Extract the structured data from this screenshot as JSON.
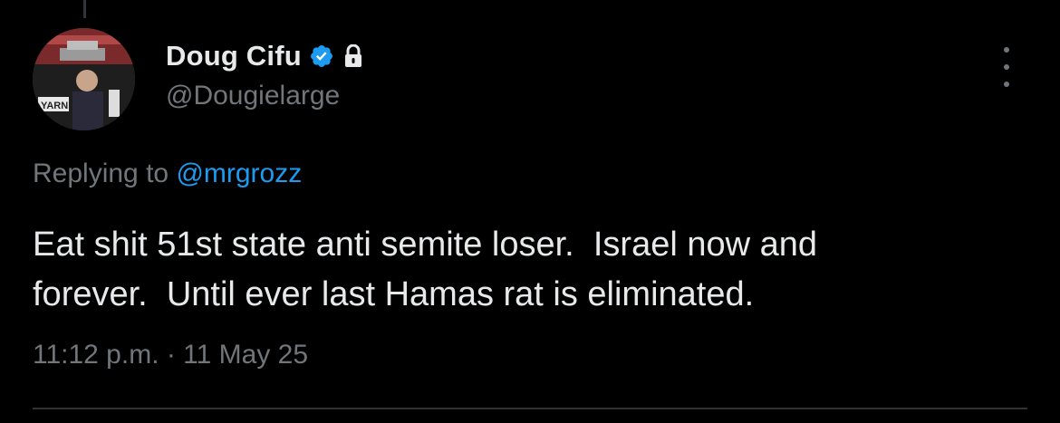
{
  "tweet": {
    "author": {
      "display_name": "Doug Cifu",
      "handle": "@Dougielarge",
      "verified": true,
      "protected": true,
      "avatar_text": "YARN"
    },
    "reply": {
      "prefix": "Replying to ",
      "mention": "@mrgrozz"
    },
    "text": "Eat shit 51st state anti semite loser.  Israel now and\nforever.  Until ever last Hamas rat is eliminated.",
    "timestamp": "11:12 p.m. · 11 May 25",
    "icons": {
      "verified": "verified-badge-icon",
      "lock": "lock-icon",
      "more": "more-options-icon"
    },
    "colors": {
      "background": "#000000",
      "primary_text": "#e7e9ea",
      "secondary_text": "#71767b",
      "accent": "#1d9bf0"
    }
  }
}
